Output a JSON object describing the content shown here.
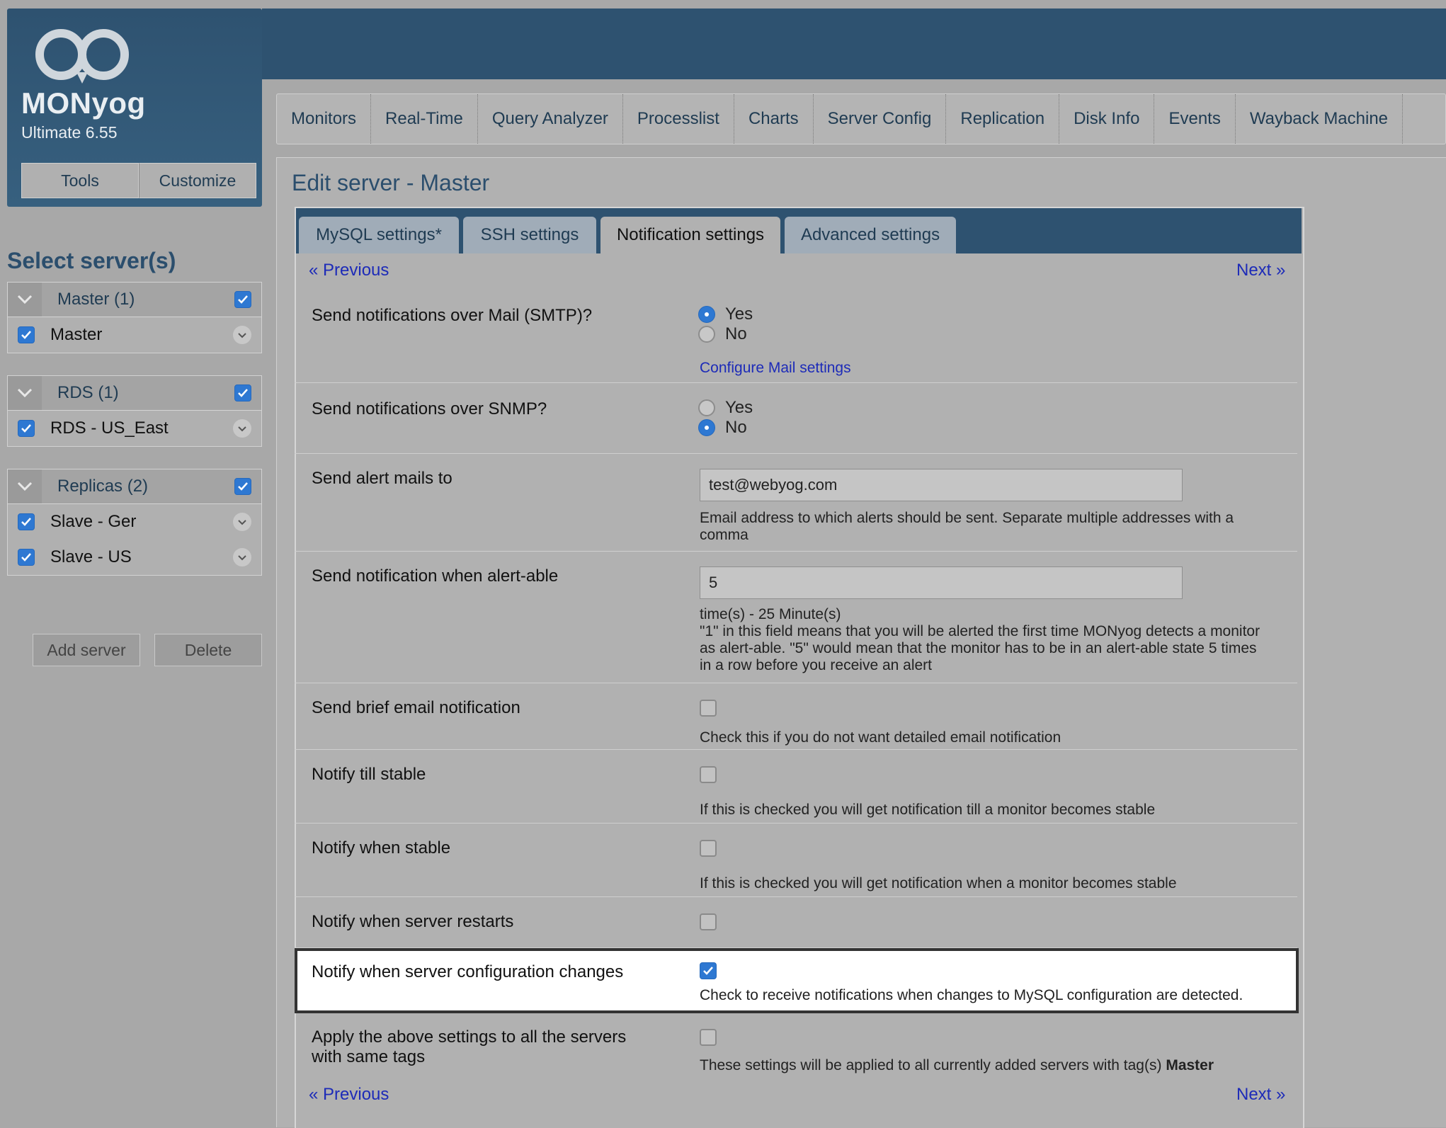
{
  "brand": {
    "name": "MONyog",
    "version": "Ultimate 6.55",
    "tools_label": "Tools",
    "customize_label": "Customize"
  },
  "nav": [
    "Monitors",
    "Real-Time",
    "Query Analyzer",
    "Processlist",
    "Charts",
    "Server Config",
    "Replication",
    "Disk Info",
    "Events",
    "Wayback Machine"
  ],
  "sidebar": {
    "title": "Select server(s)",
    "groups": [
      {
        "label": "Master (1)",
        "servers": [
          "Master"
        ]
      },
      {
        "label": "RDS (1)",
        "servers": [
          "RDS - US_East"
        ]
      },
      {
        "label": "Replicas (2)",
        "servers": [
          "Slave - Ger",
          "Slave - US"
        ]
      }
    ],
    "add_label": "Add server",
    "delete_label": "Delete"
  },
  "main": {
    "title": "Edit server - Master",
    "tabs": [
      "MySQL settings*",
      "SSH settings",
      "Notification settings",
      "Advanced settings"
    ],
    "active_tab": "Notification settings",
    "prev_label": "« Previous",
    "next_label": "Next »",
    "rows": {
      "smtp": {
        "label": "Send notifications over Mail (SMTP)?",
        "yes": "Yes",
        "no": "No",
        "selected": "Yes",
        "link": "Configure Mail settings"
      },
      "snmp": {
        "label": "Send notifications over SNMP?",
        "yes": "Yes",
        "no": "No",
        "selected": "No"
      },
      "alert_mails": {
        "label": "Send alert mails to",
        "value": "test@webyog.com",
        "help": "Email address to which alerts should be sent. Separate multiple addresses with a comma"
      },
      "alertable": {
        "label": "Send notification when alert-able",
        "value": "5",
        "help1": "time(s) - 25 Minute(s)",
        "help2": "\"1\" in this field means that you will be alerted the first time MONyog detects a monitor as alert-able. \"5\" would mean that the monitor has to be in an alert-able state 5 times in a row before you receive an alert"
      },
      "brief": {
        "label": "Send brief email notification",
        "help": "Check this if you do not want detailed email notification",
        "checked": false
      },
      "till_stable": {
        "label": "Notify till stable",
        "help": "If this is checked you will get notification till a monitor becomes stable",
        "checked": false
      },
      "when_stable": {
        "label": "Notify when stable",
        "help": "If this is checked you will get notification when a monitor becomes stable",
        "checked": false
      },
      "restarts": {
        "label": "Notify when server restarts",
        "checked": false
      },
      "config_changes": {
        "label": "Notify when server configuration changes",
        "help": "Check to receive notifications when changes to MySQL configuration are detected.",
        "checked": true
      },
      "apply_all": {
        "label_line1": "Apply the above settings to all the servers",
        "label_line2": "with same tags",
        "help": "These settings will be applied to all currently added servers with tag(s)",
        "tag": "Master",
        "checked": false
      }
    }
  }
}
